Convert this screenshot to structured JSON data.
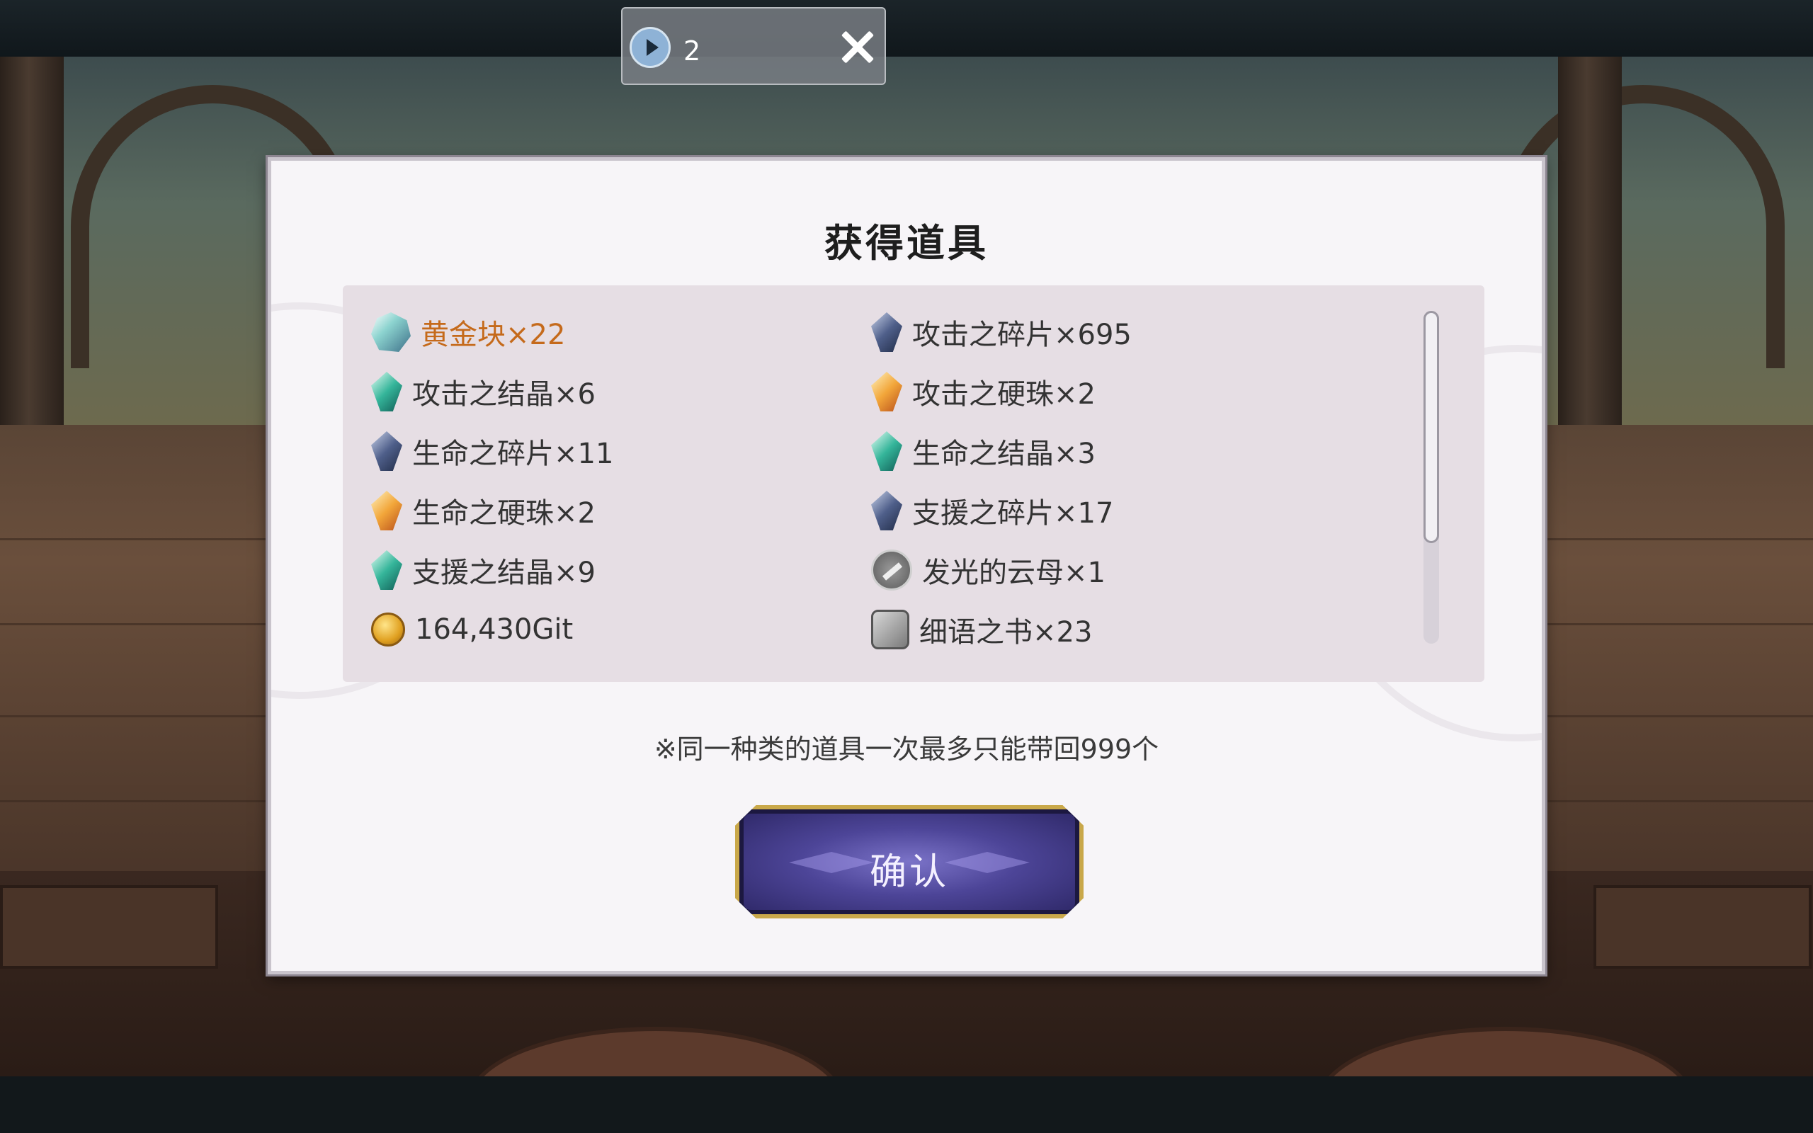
{
  "notification": {
    "count": "2"
  },
  "dialog": {
    "title": "获得道具",
    "items": [
      {
        "label": "黄金块×22",
        "icon": "gold-ore-icon",
        "highlight": true
      },
      {
        "label": "攻击之碎片×695",
        "icon": "attack-shard-icon"
      },
      {
        "label": "攻击之结晶×6",
        "icon": "attack-crystal-icon"
      },
      {
        "label": "攻击之硬珠×2",
        "icon": "attack-orb-icon"
      },
      {
        "label": "生命之碎片×11",
        "icon": "life-shard-icon"
      },
      {
        "label": "生命之结晶×3",
        "icon": "life-crystal-icon"
      },
      {
        "label": "生命之硬珠×2",
        "icon": "life-orb-icon"
      },
      {
        "label": "支援之碎片×17",
        "icon": "support-shard-icon"
      },
      {
        "label": "支援之结晶×9",
        "icon": "support-crystal-icon"
      },
      {
        "label": "发光的云母×1",
        "icon": "key-icon"
      },
      {
        "label": "164,430Git",
        "icon": "coin-icon"
      },
      {
        "label": "细语之书×23",
        "icon": "book-icon"
      }
    ],
    "note": "※同一种类的道具一次最多只能带回999个",
    "confirm_label": "确认"
  },
  "colors": {
    "highlight_text": "#c56a1b",
    "button_gold": "#c9a84a",
    "button_purple": "#4d4598"
  }
}
